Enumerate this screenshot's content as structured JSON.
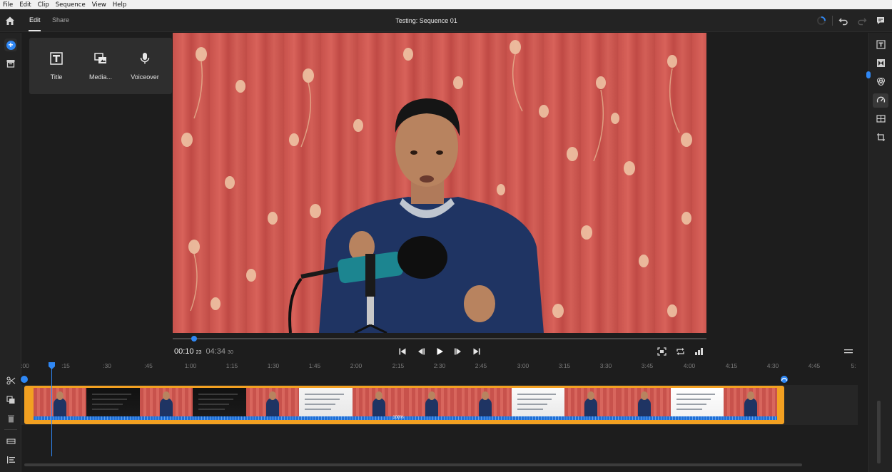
{
  "menu": [
    "File",
    "Edit",
    "Clip",
    "Sequence",
    "View",
    "Help"
  ],
  "header": {
    "tabs": [
      {
        "label": "Edit",
        "active": true
      },
      {
        "label": "Share",
        "active": false
      }
    ],
    "sequence_title": "Testing: Sequence 01"
  },
  "add_panel": {
    "items": [
      {
        "label": "Title",
        "icon": "title-icon"
      },
      {
        "label": "Media...",
        "icon": "media-icon"
      },
      {
        "label": "Voiceover",
        "icon": "microphone-icon"
      }
    ]
  },
  "player": {
    "current_time": "00:10",
    "current_frames": "23",
    "duration": "04:34",
    "duration_frames": "30",
    "progress": 0.04
  },
  "timeline": {
    "ruler_ticks": [
      ":00",
      ":15",
      ":30",
      ":45",
      "1:00",
      "1:15",
      "1:30",
      "1:45",
      "2:00",
      "2:15",
      "2:30",
      "2:45",
      "3:00",
      "3:15",
      "3:30",
      "3:45",
      "4:00",
      "4:15",
      "4:30",
      "4:45",
      "5:"
    ],
    "clip_speed_label": "100%",
    "thumbnails": [
      "person",
      "screen-dark",
      "person",
      "screen-dark",
      "person",
      "screen-desktop",
      "person",
      "person",
      "person",
      "screen-light",
      "person",
      "person",
      "screen-doc",
      "person"
    ]
  },
  "colors": {
    "accent": "#2f87f4",
    "clip_border": "#f2a021",
    "background": "#1d1d1d"
  }
}
